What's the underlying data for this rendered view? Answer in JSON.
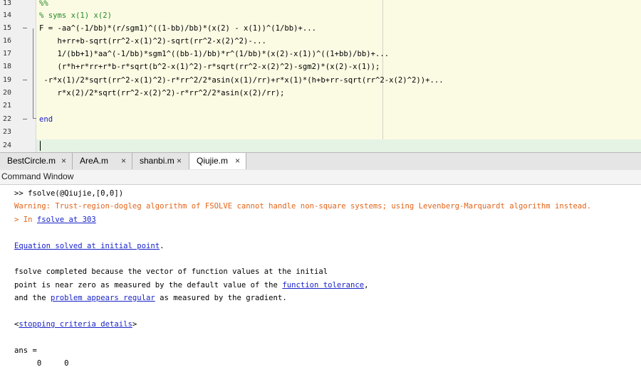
{
  "editor": {
    "lines": [
      {
        "num": "13",
        "dash": "",
        "text": "%%"
      },
      {
        "num": "14",
        "dash": "",
        "text": "% syms x(1) x(2)"
      },
      {
        "num": "15",
        "dash": "–",
        "text": "F = -aa^(-1/bb)*(r/sgm1)^((1-bb)/bb)*(x(2) - x(1))^(1/bb)+..."
      },
      {
        "num": "16",
        "dash": "",
        "text": "    h+rr+b-sqrt(rr^2-x(1)^2)-sqrt(rr^2-x(2)^2)-..."
      },
      {
        "num": "17",
        "dash": "",
        "text": "    1/(bb+1)*aa^(-1/bb)*sgm1^((bb-1)/bb)*r^(1/bb)*(x(2)-x(1))^((1+bb)/bb)+..."
      },
      {
        "num": "18",
        "dash": "",
        "text": "    (r*h+r*rr+r*b-r*sqrt(b^2-x(1)^2)-r*sqrt(rr^2-x(2)^2)-sgm2)*(x(2)-x(1));"
      },
      {
        "num": "19",
        "dash": "–",
        "text": " -r*x(1)/2*sqrt(rr^2-x(1)^2)-r*rr^2/2*asin(x(1)/rr)+r*x(1)*(h+b+rr-sqrt(rr^2-x(2)^2))+..."
      },
      {
        "num": "20",
        "dash": "",
        "text": "    r*x(2)/2*sqrt(rr^2-x(2)^2)-r*rr^2/2*asin(x(2)/rr);"
      },
      {
        "num": "21",
        "dash": "",
        "text": ""
      },
      {
        "num": "22",
        "dash": "–",
        "text": "end"
      },
      {
        "num": "23",
        "dash": "",
        "text": ""
      },
      {
        "num": "24",
        "dash": "",
        "text": ""
      }
    ]
  },
  "tabs": [
    {
      "label": "BestCircle.m",
      "close": "×"
    },
    {
      "label": "AreA.m",
      "close": "×"
    },
    {
      "label": "shanbi.m",
      "close": "×"
    },
    {
      "label": "Qiujie.m",
      "close": "×"
    }
  ],
  "command_window": {
    "title": "Command Window",
    "prompt": ">> fsolve(@Qiujie,[0,0])",
    "warning": "Warning: Trust-region-dogleg algorithm of FSOLVE cannot handle non-square systems; using Levenberg-Marquardt algorithm instead.",
    "warning_loc_prefix": "> In ",
    "warning_loc_link": "fsolve at 303",
    "solved_link": "Equation solved at initial point",
    "solved_suffix": ".",
    "para1": "fsolve completed because the vector of function values at the initial",
    "para2_prefix": "point is near zero as measured by the default value of the ",
    "para2_link": "function tolerance",
    "para2_suffix": ",",
    "para3_prefix": "and the ",
    "para3_link": "problem appears regular",
    "para3_suffix": " as measured by the gradient.",
    "criteria_open": "<",
    "criteria_link": "stopping criteria details",
    "criteria_close": ">",
    "ans_label": "ans =",
    "ans_values": "     0     0"
  }
}
